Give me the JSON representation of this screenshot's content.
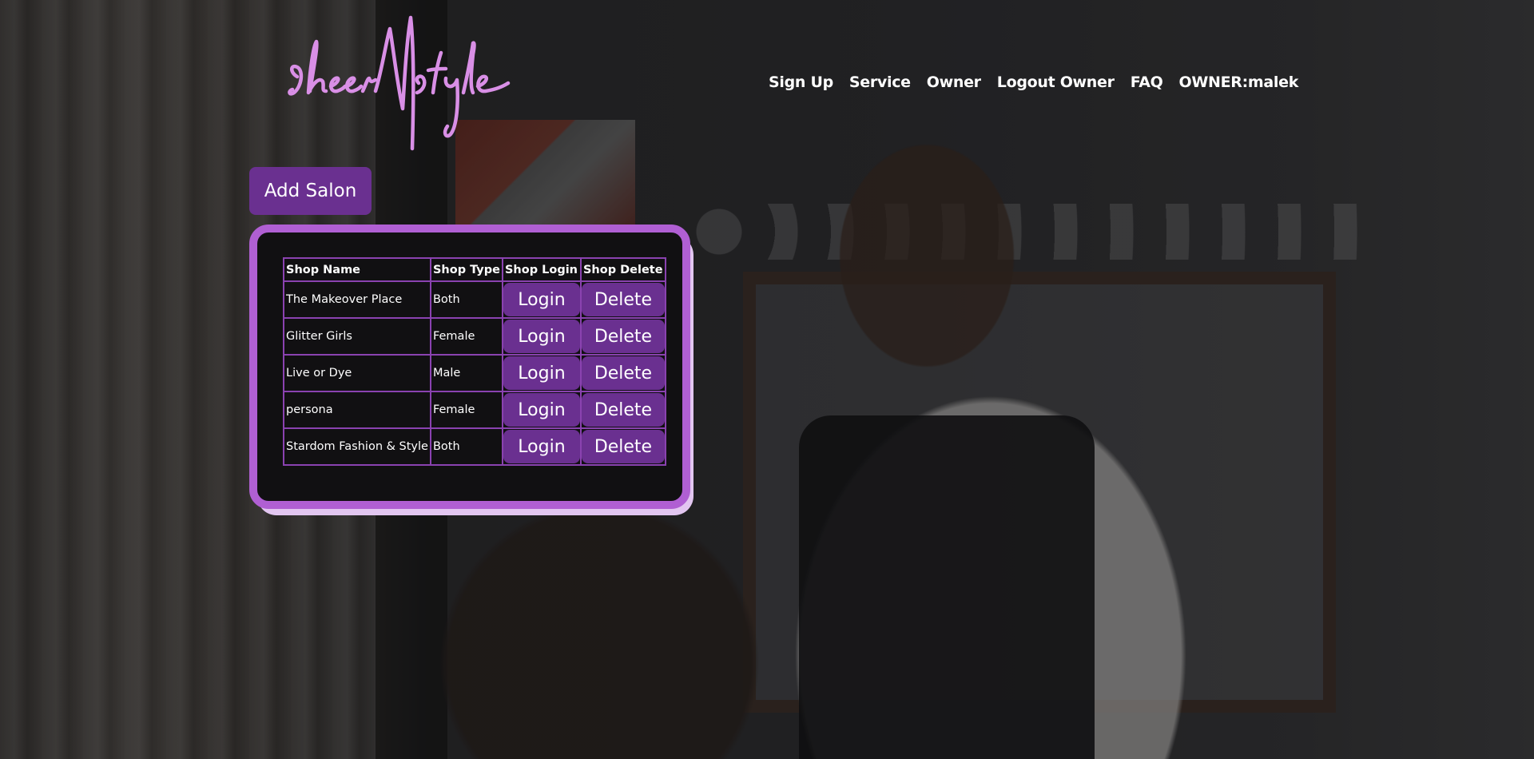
{
  "brand": {
    "logo_text": "sheerNstyle",
    "logo_color": "#d98fe6"
  },
  "nav": {
    "items": [
      {
        "label": "Sign Up"
      },
      {
        "label": "Service"
      },
      {
        "label": "Owner"
      },
      {
        "label": "Logout Owner"
      },
      {
        "label": "FAQ"
      },
      {
        "label": "OWNER:malek"
      }
    ]
  },
  "actions": {
    "add_salon_label": "Add Salon"
  },
  "table": {
    "headers": [
      "Shop Name",
      "Shop Type",
      "Shop Login",
      "Shop Delete"
    ],
    "rows": [
      {
        "name": "The Makeover Place",
        "type": "Both",
        "login": "Login",
        "delete": "Delete"
      },
      {
        "name": "Glitter Girls",
        "type": "Female",
        "login": "Login",
        "delete": "Delete"
      },
      {
        "name": "Live or Dye",
        "type": "Male",
        "login": "Login",
        "delete": "Delete"
      },
      {
        "name": "persona",
        "type": "Female",
        "login": "Login",
        "delete": "Delete"
      },
      {
        "name": "Stardom Fashion & Style",
        "type": "Both",
        "login": "Login",
        "delete": "Delete"
      }
    ]
  },
  "colors": {
    "accent": "#6a3090",
    "panel_border": "#b05fd3",
    "panel_shadow": "#e2c6f0",
    "table_border": "#8a42b0"
  }
}
